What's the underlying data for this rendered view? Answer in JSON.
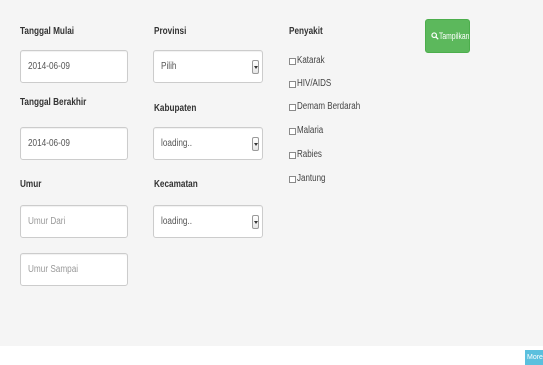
{
  "filters": {
    "start_date": {
      "label": "Tanggal Mulai",
      "value": "2014-06-09"
    },
    "end_date": {
      "label": "Tanggal Berakhir",
      "value": "2014-06-09"
    },
    "age": {
      "label": "Umur",
      "from_placeholder": "Umur Dari",
      "to_placeholder": "Umur Sampai"
    },
    "province": {
      "label": "Provinsi",
      "selected": "Pilih"
    },
    "regency": {
      "label": "Kabupaten",
      "selected": "loading.."
    },
    "district": {
      "label": "Kecamatan",
      "selected": "loading.."
    },
    "disease": {
      "label": "Penyakit",
      "options": [
        "Katarak",
        "HIV/AIDS",
        "Demam Berdarah",
        "Malaria",
        "Rabies",
        "Jantung"
      ]
    }
  },
  "actions": {
    "show_button": {
      "label": "Tampilkan",
      "icon": "search-icon",
      "color": "#5cb85c"
    },
    "corner_button": {
      "label": "More",
      "color": "#5bc0de"
    }
  }
}
